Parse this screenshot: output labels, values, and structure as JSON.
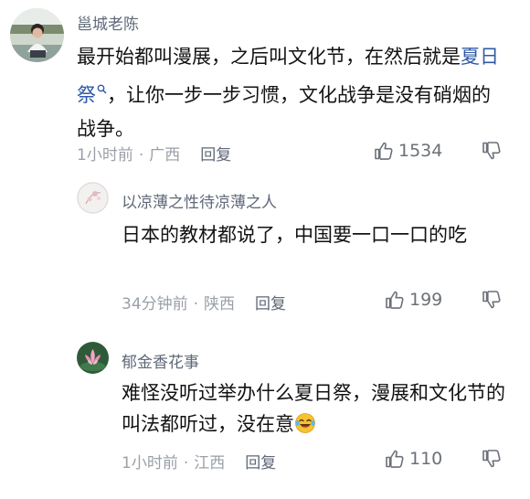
{
  "comments": [
    {
      "username": "邕城老陈",
      "text_before": "最开始都叫漫展，之后叫文化节，在然后就是",
      "link": "夏日祭",
      "text_after": "，让你一步一步习惯，文化战争是没有硝烟的战争。",
      "time": "1小时前",
      "location": "广西",
      "reply_label": "回复",
      "likes": "1534",
      "avatar_icon": "person-photo-avatar"
    },
    {
      "username": "以凉薄之性待凉薄之人",
      "text": "日本的教材都说了，中国要一口一口的吃",
      "time": "34分钟前",
      "location": "陕西",
      "reply_label": "回复",
      "likes": "199",
      "avatar_icon": "flower-sketch-avatar"
    },
    {
      "username": "郁金香花事",
      "text": "难怪没听过举办什么夏日祭，漫展和文化节的叫法都听过，没在意",
      "emoji": "laughing-tears-emoji",
      "time": "1小时前",
      "location": "江西",
      "reply_label": "回复",
      "likes": "110",
      "avatar_icon": "lotus-avatar"
    }
  ],
  "icons": {
    "like": "thumbs-up-icon",
    "dislike": "thumbs-down-icon",
    "search_mark": "search-icon"
  },
  "colors": {
    "link": "#2f5aa8",
    "username": "#5f6878",
    "meta": "#9aa0a8",
    "emoji": "#f7c22f"
  }
}
